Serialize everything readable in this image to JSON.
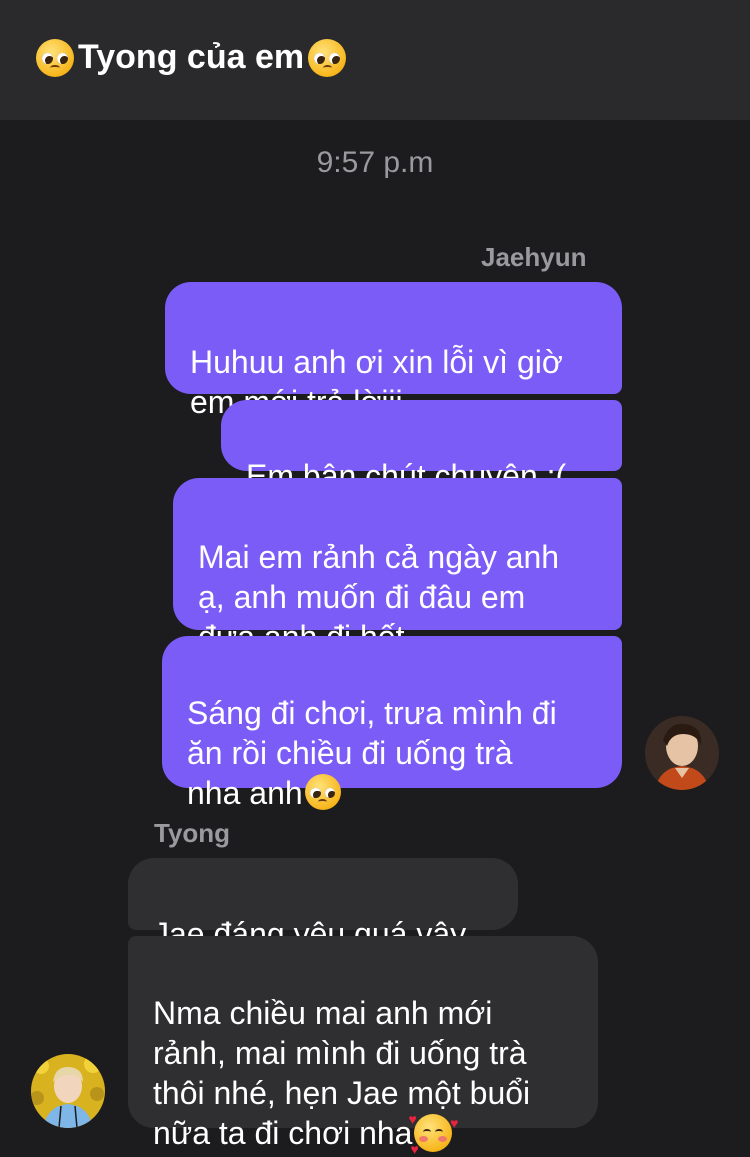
{
  "header": {
    "title": "Tyong của em",
    "left_icon": "pleading-face-emoji",
    "right_icon": "pleading-face-emoji"
  },
  "timestamp": "9:57 p.m",
  "outgoing": {
    "sender": "Jaehyun",
    "messages": [
      "Huhuu anh ơi xin lỗi vì giờ\nem mới trả lờiii",
      "Em bận chút chuyện :(",
      "Mai em rảnh cả ngày anh\nạ, anh muốn đi đâu em\nđưa anh đi hết",
      "Sáng đi chơi, trưa mình đi\năn rồi chiều đi uống trà\nnha anh"
    ]
  },
  "incoming": {
    "sender": "Tyong",
    "messages": [
      "Jae đáng yêu quá vậy",
      "Nma chiều mai anh mới\nrảnh, mai mình đi uống trà\nthôi nhé, hẹn Jae một buổi\nnữa ta đi chơi nha"
    ]
  },
  "colors": {
    "background": "#1c1c1e",
    "header_bg": "#2a2a2c",
    "outgoing_bubble": "#7b5cf7",
    "incoming_bubble": "#2f2f31",
    "muted_text": "#9a9a9e"
  }
}
